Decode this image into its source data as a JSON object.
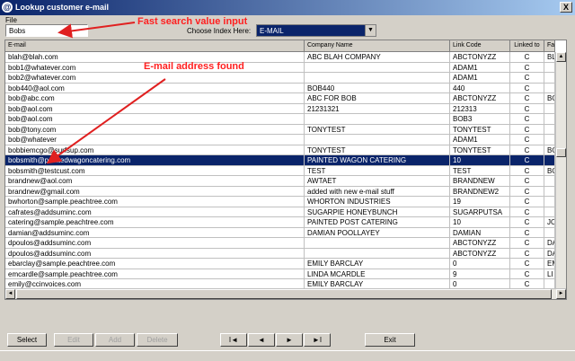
{
  "window": {
    "title": "Lookup customer e-mail",
    "close_label": "X"
  },
  "menu": {
    "file": "File"
  },
  "search": {
    "value": "Bobs"
  },
  "index": {
    "label": "Choose Index Here:",
    "selected": "E-MAIL"
  },
  "annotations": {
    "search": "Fast search value input",
    "found": "E-mail address found",
    "color": "#ff2020"
  },
  "columns": [
    "E-mail",
    "Company Name",
    "Link Code",
    "Linked to",
    "Fa"
  ],
  "rows": [
    [
      "blah@blah.com",
      "ABC BLAH COMPANY",
      "ABCTONYZZ",
      "C",
      "BL"
    ],
    [
      "bob1@whatever.com",
      "",
      "ADAM1",
      "C",
      ""
    ],
    [
      "bob2@whatever.com",
      "",
      "ADAM1",
      "C",
      ""
    ],
    [
      "bob440@aol.com",
      "BOB440",
      "440",
      "C",
      ""
    ],
    [
      "bob@abc.com",
      "ABC FOR BOB",
      "ABCTONYZZ",
      "C",
      "BO"
    ],
    [
      "bob@aol.com",
      "21231321",
      "212313",
      "C",
      ""
    ],
    [
      "bob@aol.com",
      "",
      "BOB3",
      "C",
      ""
    ],
    [
      "bob@tony.com",
      "TONYTEST",
      "TONYTEST",
      "C",
      ""
    ],
    [
      "bob@whatever",
      "",
      "ADAM1",
      "C",
      ""
    ],
    [
      "bobbiemcgo@surfsup.com",
      "TONYTEST",
      "TONYTEST",
      "C",
      "BO"
    ],
    [
      "bobsmith@paintedwagoncatering.com",
      "PAINTED WAGON CATERING",
      "10",
      "C",
      ""
    ],
    [
      "bobsmith@testcust.com",
      "TEST",
      "TEST",
      "C",
      "BO"
    ],
    [
      "brandnew@aol.com",
      "AWTAET",
      "BRANDNEW",
      "C",
      ""
    ],
    [
      "brandnew@gmail.com",
      "added with new e-mail stuff",
      "BRANDNEW2",
      "C",
      ""
    ],
    [
      "bwhorton@sample.peachtree.com",
      "WHORTON INDUSTRIES",
      "19",
      "C",
      ""
    ],
    [
      "cafrates@addsuminc.com",
      "SUGARPIE HONEYBUNCH",
      "SUGARPUTSA",
      "C",
      ""
    ],
    [
      "catering@sample.peachtree.com",
      "PAINTED POST CATERING",
      "10",
      "C",
      "JC"
    ],
    [
      "damian@addsuminc.com",
      "DAMIAN POOLLAYEY",
      "DAMIAN",
      "C",
      ""
    ],
    [
      "dpoulos@addsuminc.com",
      "",
      "ABCTONYZZ",
      "C",
      "DA"
    ],
    [
      "dpoulos@addsuminc.com",
      "",
      "ABCTONYZZ",
      "C",
      "DA"
    ],
    [
      "ebarclay@sample.peachtree.com",
      "EMILY BARCLAY",
      "0",
      "C",
      "EM"
    ],
    [
      "emcardle@sample.peachtree.com",
      "LINDA MCARDLE",
      "9",
      "C",
      "LI"
    ],
    [
      "emily@ccinvoices.com",
      "EMILY BARCLAY",
      "0",
      "C",
      ""
    ]
  ],
  "selected_row": 10,
  "buttons": {
    "select": "Select",
    "edit": "Edit",
    "add": "Add",
    "delete": "Delete",
    "first": "I◄",
    "prev": "◄",
    "next": "►",
    "last": "►I",
    "exit": "Exit"
  }
}
